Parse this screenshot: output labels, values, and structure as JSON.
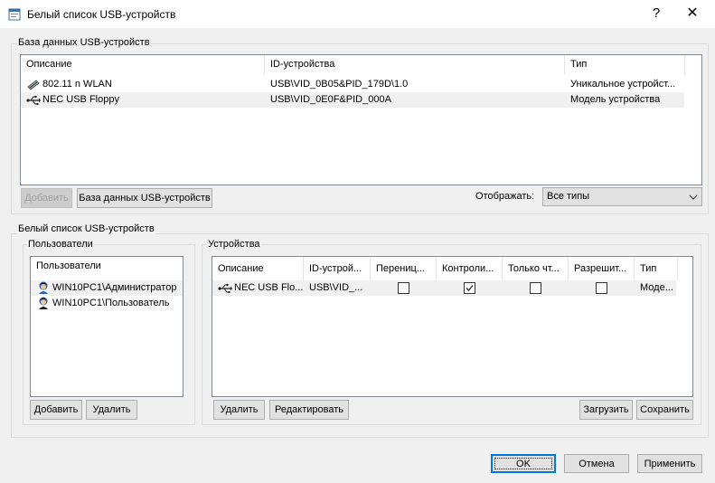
{
  "window": {
    "title": "Белый список USB-устройств",
    "help_glyph": "?",
    "close_glyph": "✕"
  },
  "db_group": {
    "title": "База данных USB-устройств",
    "columns": [
      "Описание",
      "ID-устройства",
      "Тип"
    ],
    "rows": [
      {
        "icon": "network-card-icon",
        "description": "802.11 n WLAN",
        "device_id": "USB\\VID_0B05&PID_179D\\1.0",
        "type": "Уникальное устройст..."
      },
      {
        "icon": "usb-icon",
        "description": "NEC USB Floppy",
        "device_id": "USB\\VID_0E0F&PID_000A",
        "type": "Модель устройства"
      }
    ],
    "add_button": "Добавить",
    "db_button": "База данных USB-устройств",
    "display_label": "Отображать:",
    "display_value": "Все типы"
  },
  "whitelist_group": {
    "title": "Белый список USB-устройств",
    "users_panel": {
      "title": "Пользователи",
      "column": "Пользователи",
      "rows": [
        {
          "icon": "admin-user-icon",
          "name": "WIN10PC1\\Администратор"
        },
        {
          "icon": "user-icon",
          "name": "WIN10PC1\\Пользователь"
        }
      ],
      "add_button": "Добавить",
      "delete_button": "Удалить"
    },
    "devices_panel": {
      "title": "Устройства",
      "columns": [
        "Описание",
        "ID-устрой...",
        "Перениц...",
        "Контроли...",
        "Только чт...",
        "Разрешит...",
        "Тип"
      ],
      "rows": [
        {
          "icon": "usb-icon",
          "description": "NEC USB Flo...",
          "device_id": "USB\\VID_...",
          "checks": [
            false,
            true,
            false,
            false
          ],
          "type": "Моде..."
        }
      ],
      "delete_button": "Удалить",
      "edit_button": "Редактировать",
      "load_button": "Загрузить",
      "save_button": "Сохранить"
    }
  },
  "footer": {
    "ok_button": "OK",
    "cancel_button": "Отмена",
    "apply_button": "Применить"
  }
}
